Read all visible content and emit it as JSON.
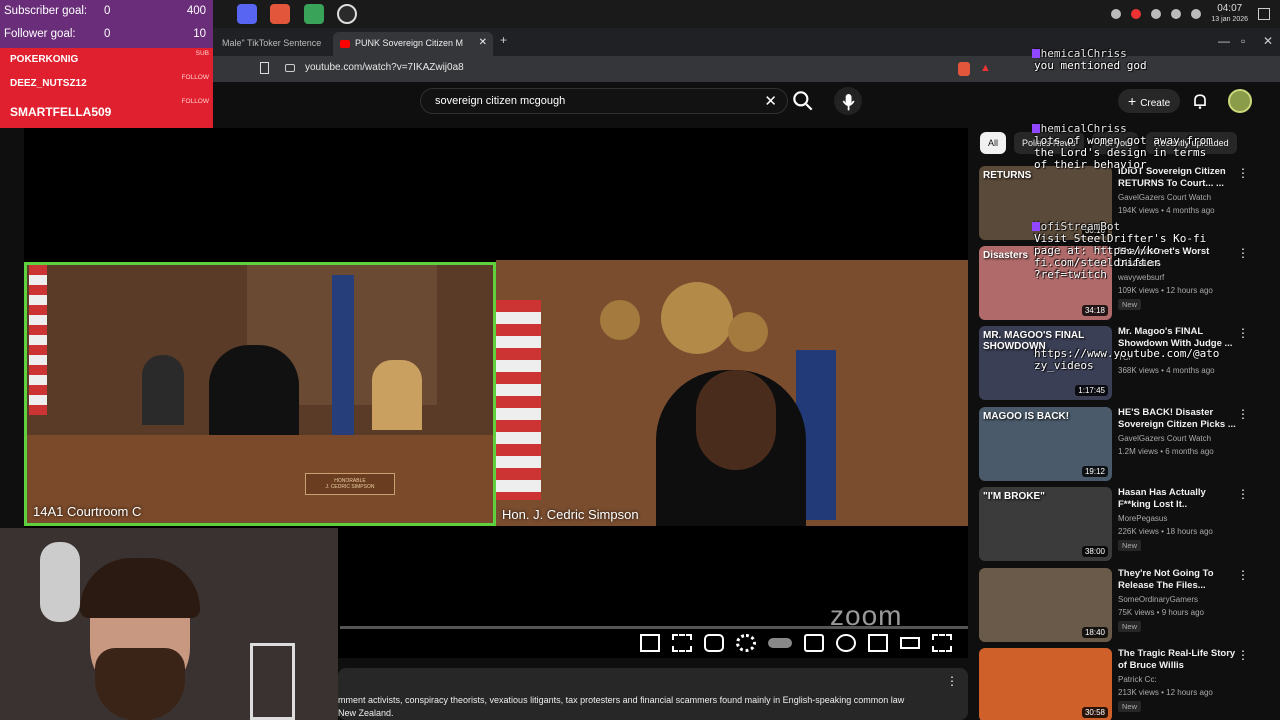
{
  "stream_overlay": {
    "goals": [
      {
        "label": "Subscriber goal:",
        "current": "0",
        "target": "400"
      },
      {
        "label": "Follower goal:",
        "current": "0",
        "target": "10"
      }
    ],
    "alerts": [
      {
        "name": "POKERKONIG",
        "type": "SUB"
      },
      {
        "name": "DEEZ_NUTSZ12",
        "type": "FOLLOW"
      },
      {
        "name": "SMARTFELLA509",
        "type": "FOLLOW"
      }
    ],
    "chat": [
      {
        "user": "ChemicalChriss",
        "message": "you mentioned god"
      },
      {
        "user": "ChemicalChriss",
        "message": "lots of women got away from\nthe Lord's design in terms\nof their behavior"
      },
      {
        "user": "KofiStreamBot",
        "message": "Visit SteelDrifter's Ko-fi\npage at: https://ko-\nfi.com/steeldrifter\n?ref=twitch"
      },
      {
        "user": "",
        "message": "https://www.youtube.com/@ato\nzy_videos"
      }
    ]
  },
  "taskbar": {
    "time": "04:07",
    "date": "13 jan 2026"
  },
  "browser": {
    "tabs": [
      {
        "label": "Male\" TikToker Sentence",
        "active": false
      },
      {
        "label": "PUNK Sovereign Citizen M",
        "active": true
      }
    ],
    "new_tab": "+",
    "url": "youtube.com/watch?v=7IKAZwij0a8"
  },
  "youtube": {
    "search_query": "sovereign citizen mcgough",
    "create_label": "Create",
    "chips": [
      "All",
      "Politics News",
      "For you",
      "Recently uploaded"
    ],
    "player": {
      "left_caption": "14A1 Courtroom C",
      "right_caption": "Hon. J. Cedric Simpson",
      "nameplate": "HONORABLE\nJ. CEDRIC SIMPSON",
      "watermark": "zoom"
    },
    "description": "mment activists, conspiracy theorists, vexatious litigants, tax protesters and financial scammers found mainly in English-speaking common law\nNew Zealand.",
    "recommendations": [
      {
        "title": "IDIOT Sovereign Citizen RETURNS To Court... ...",
        "channel": "GavelGazers Court Watch",
        "meta": "194K views • 4 months ago",
        "duration": "30:16",
        "badge": "",
        "thumb_text": "RETURNS",
        "thumb_color": "#5a4a3a"
      },
      {
        "title": "The Internet's Worst Disasters",
        "channel": "wavywebsurf",
        "meta": "109K views • 12 hours ago",
        "duration": "34:18",
        "badge": "New",
        "thumb_text": "Disasters",
        "thumb_color": "#b06a6a"
      },
      {
        "title": "Mr. Magoo's FINAL Showdown With Judge ...",
        "channel": "TCF",
        "meta": "368K views • 4 months ago",
        "duration": "1:17:45",
        "badge": "",
        "thumb_text": "MR. MAGOO'S FINAL SHOWDOWN",
        "thumb_color": "#3a3f55"
      },
      {
        "title": "HE'S BACK! Disaster Sovereign Citizen Picks ...",
        "channel": "GavelGazers Court Watch",
        "meta": "1.2M views • 6 months ago",
        "duration": "19:12",
        "badge": "",
        "thumb_text": "MAGOO IS BACK!",
        "thumb_color": "#4a5a6a"
      },
      {
        "title": "Hasan Has Actually F**king Lost It..",
        "channel": "MorePegasus",
        "meta": "226K views • 18 hours ago",
        "duration": "38:00",
        "badge": "New",
        "thumb_text": "\"I'M BROKE\"",
        "thumb_color": "#3b3b3b"
      },
      {
        "title": "They're Not Going To Release The Files...",
        "channel": "SomeOrdinaryGamers",
        "meta": "75K views • 9 hours ago",
        "duration": "18:40",
        "badge": "New",
        "thumb_text": "",
        "thumb_color": "#6a5a4a"
      },
      {
        "title": "The Tragic Real-Life Story of Bruce Willis",
        "channel": "Patrick Cc:",
        "meta": "213K views • 12 hours ago",
        "duration": "30:58",
        "badge": "New",
        "thumb_text": "",
        "thumb_color": "#d0602a"
      }
    ]
  }
}
